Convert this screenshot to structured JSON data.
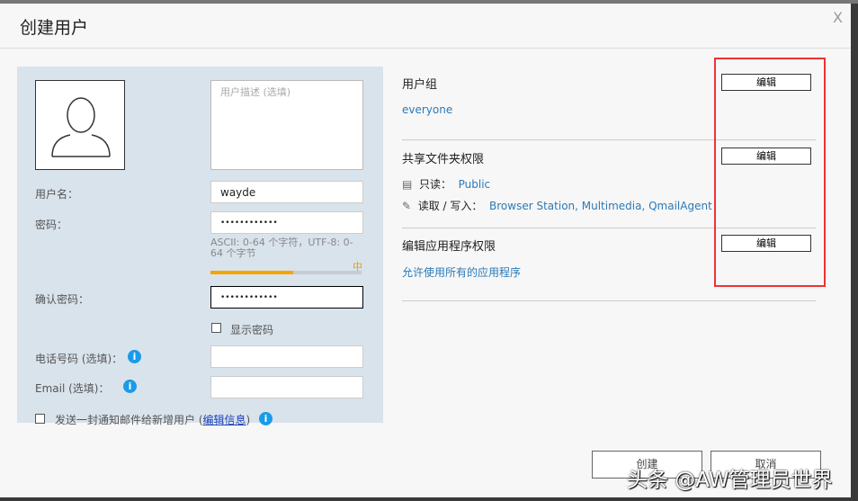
{
  "dialog": {
    "title": "创建用户",
    "close": "X"
  },
  "form": {
    "description_placeholder": "用户描述 (选填)",
    "username_label": "用户名：",
    "username_value": "wayde",
    "password_label": "密码：",
    "password_value": "••••••••••••",
    "password_hint": "ASCII: 0-64 个字符，UTF-8: 0-64 个字节",
    "strength_label": "中",
    "strength_percent": 55,
    "confirm_label": "确认密码：",
    "confirm_value": "••••••••••••",
    "show_password": "显示密码",
    "phone_label": "电话号码 (选填)：",
    "email_label": "Email (选填)：",
    "notify_label": "发送一封通知邮件给新增用户 (",
    "notify_link": "编辑信息",
    "notify_close": ")"
  },
  "permissions": {
    "group_title": "用户组",
    "group_value": "everyone",
    "share_title": "共享文件夹权限",
    "readonly_label": "只读：",
    "readonly_value": "Public",
    "readwrite_label": "读取 / 写入：",
    "readwrite_value": "Browser Station, Multimedia, QmailAgent",
    "app_title": "编辑应用程序权限",
    "app_value": "允许使用所有的应用程序",
    "edit": "编辑"
  },
  "footer": {
    "create": "创建",
    "cancel": "取消"
  },
  "watermark": "头条 @AW管理员世界"
}
